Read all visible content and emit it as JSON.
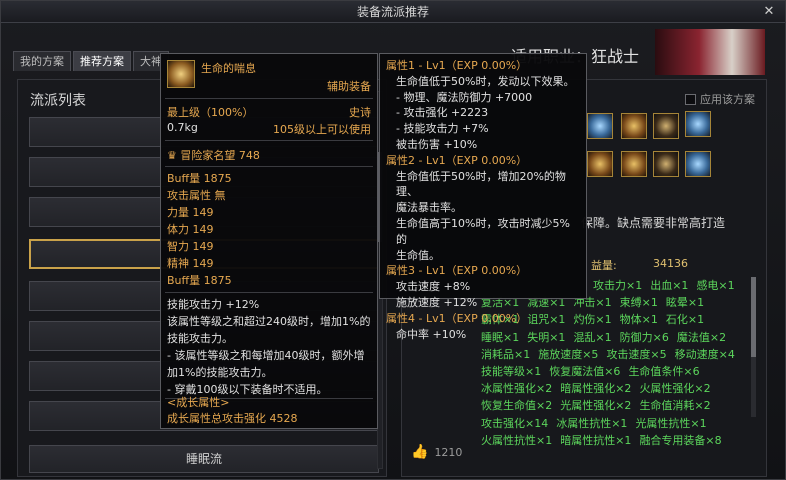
{
  "window": {
    "title": "装备流派推荐",
    "close": "✕"
  },
  "tabs": [
    {
      "label": "我的方案"
    },
    {
      "label": "推荐方案"
    },
    {
      "label": "大神"
    }
  ],
  "left": {
    "title": "流派列表",
    "bottom_item": "睡眠流"
  },
  "right": {
    "header": "适用职业：狂战士",
    "apply_label": "应用该方案",
    "desc_fragment": "保障。缺点需要非常高打造",
    "gain_label": "益量:",
    "gain_value": "34136",
    "likes": "1210",
    "attributes": [
      [
        "攻击力×1",
        "出血×1",
        "感电×1"
      ],
      [
        "复活×1",
        "减速×1",
        "冲击×1",
        "束缚×1",
        "眩晕×1"
      ],
      [
        "霸体×1",
        "诅咒×1",
        "灼伤×1",
        "物体×1",
        "石化×1"
      ],
      [
        "睡眠×1",
        "失明×1",
        "混乱×1",
        "防御力×6",
        "魔法值×2"
      ],
      [
        "消耗品×1",
        "施放速度×5",
        "攻击速度×5",
        "移动速度×4"
      ],
      [
        "技能等级×1",
        "恢复魔法值×6",
        "生命值条件×6"
      ],
      [
        "冰属性强化×2",
        "暗属性强化×2",
        "火属性强化×2"
      ],
      [
        "恢复生命值×2",
        "光属性强化×2",
        "生命值消耗×2"
      ],
      [
        "攻击强化×14",
        "冰属性抗性×1",
        "光属性抗性×1"
      ],
      [
        "火属性抗性×1",
        "暗属性抗性×1",
        "融合专用装备×8"
      ]
    ]
  },
  "tooltip": {
    "name": "生命的喘息",
    "type": "辅助装备",
    "level_label": "最上级（100%）",
    "rarity": "史诗",
    "weight": "0.7kg",
    "level_req": "105级以上可以使用",
    "reputation": "冒险家名望 748",
    "stats": [
      "Buff量 1875",
      "攻击属性 無",
      "力量 149",
      "体力 149",
      "智力 149",
      "精神 149",
      "Buff量 1875"
    ],
    "effect": [
      "技能攻击力 +12%",
      "该属性等级之和超过240级时，增加1%的",
      "技能攻击力。",
      "- 该属性等级之和每增加40级时，额外增",
      "加1%的技能攻击力。",
      "- 穿戴100级以下装备时不适用。"
    ],
    "growth_title": "<成长属性>",
    "growth_value": "成长属性总攻击强化 4528"
  },
  "tooltip2": {
    "blocks": [
      {
        "head": "属性1 - Lv1（EXP 0.00%）",
        "lines": [
          "生命值低于50%时，发动以下效果。",
          "- 物理、魔法防御力 +7000",
          "- 攻击强化 +2223",
          "- 技能攻击力 +7%",
          "被击伤害 +10%"
        ]
      },
      {
        "head": "属性2 - Lv1（EXP 0.00%）",
        "lines": [
          "生命值低于50%时，增加20%的物理、",
          "魔法暴击率。",
          "生命值高于10%时，攻击时减少5%的",
          "生命值。"
        ]
      },
      {
        "head": "属性3 - Lv1（EXP 0.00%）",
        "lines": [
          "攻击速度 +8%",
          "施放速度 +12%"
        ]
      },
      {
        "head": "属性4 - Lv1（EXP 0.00%）",
        "lines": [
          "命中率 +10%"
        ]
      }
    ]
  }
}
